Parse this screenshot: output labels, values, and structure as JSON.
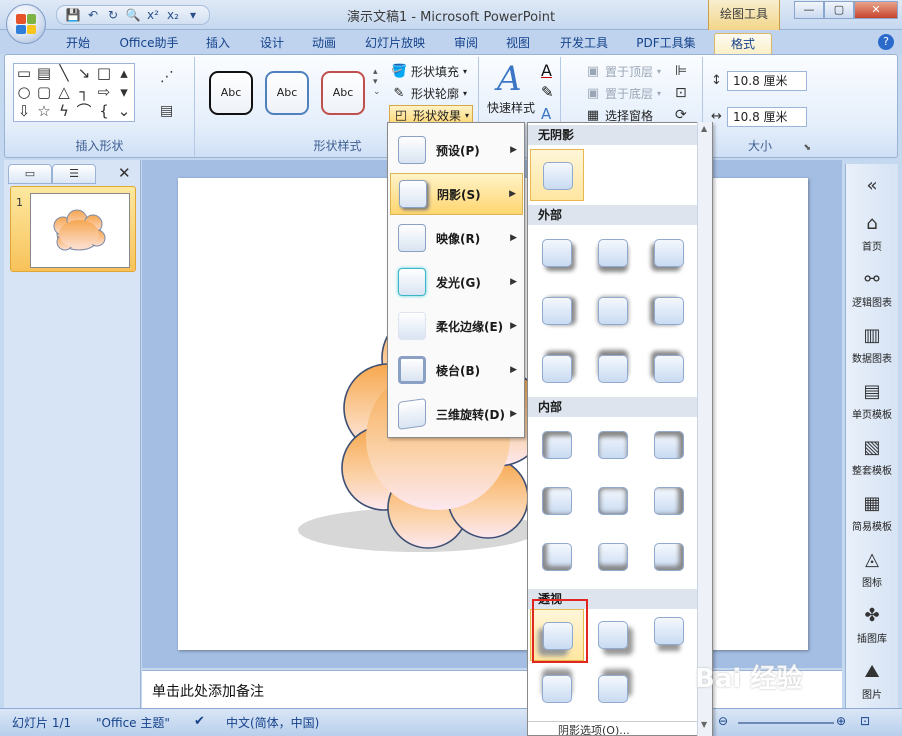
{
  "window": {
    "title": "演示文稿1 - Microsoft PowerPoint",
    "contextual_tab": "绘图工具",
    "help": "?"
  },
  "tabs": [
    "开始",
    "Office助手",
    "插入",
    "设计",
    "动画",
    "幻灯片放映",
    "审阅",
    "视图",
    "开发工具",
    "PDF工具集",
    "格式"
  ],
  "ribbon": {
    "insert_shapes": {
      "label": "插入形状"
    },
    "shape_styles": {
      "label": "形状样式",
      "style_sample": "Abc",
      "fill": "形状填充",
      "outline": "形状轮廓",
      "effects": "形状效果"
    },
    "wordart": {
      "quick_styles": "快速样式"
    },
    "arrange": {
      "bring_front": "置于顶层",
      "send_back": "置于底层",
      "selection_pane": "选择窗格"
    },
    "size": {
      "label": "大小",
      "height": "10.8 厘米",
      "width": "10.8 厘米"
    }
  },
  "effects_menu": {
    "items": [
      {
        "label": "预设(P)"
      },
      {
        "label": "阴影(S)"
      },
      {
        "label": "映像(R)"
      },
      {
        "label": "发光(G)"
      },
      {
        "label": "柔化边缘(E)"
      },
      {
        "label": "棱台(B)"
      },
      {
        "label": "三维旋转(D)"
      }
    ],
    "highlighted": "阴影(S)"
  },
  "shadow_gallery": {
    "sections": [
      "无阴影",
      "外部",
      "内部",
      "透视"
    ],
    "footer": "阴影选项(O)..."
  },
  "slides_pane": {
    "slide_number": "1"
  },
  "notes": {
    "placeholder": "单击此处添加备注"
  },
  "sidebar": {
    "items": [
      "首页",
      "逻辑图表",
      "数据图表",
      "单页模板",
      "整套模板",
      "简易模板",
      "图标",
      "插图库",
      "图片"
    ]
  },
  "statusbar": {
    "slide": "幻灯片 1/1",
    "theme": "\"Office 主题\"",
    "language": "中文(简体，中国)"
  },
  "watermark": "Bai 经验",
  "colors": {
    "accent": "#f2d588",
    "highlight": "#ffd670",
    "ribbon_bg": "#dfe9f6"
  }
}
